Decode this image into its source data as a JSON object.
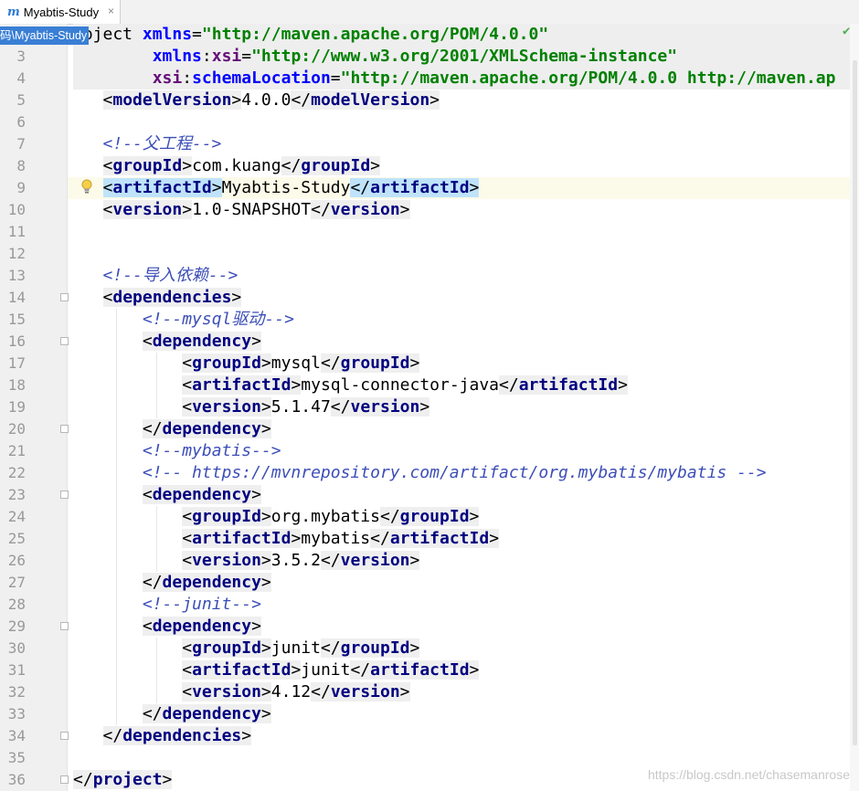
{
  "tab": {
    "title": "Myabtis-Study",
    "icon_letter": "m",
    "close": "×"
  },
  "breadcrumb": "码\\Myabtis-Study",
  "watermark": "https://blog.csdn.net/chasemanrose",
  "lines": [
    {
      "n": "",
      "top": true,
      "segs": [
        {
          "c": "pn",
          "t": "roject "
        },
        {
          "c": "an",
          "t": "xmlns"
        },
        {
          "c": "pn",
          "t": "="
        },
        {
          "c": "av",
          "t": "\"http://maven.apache.org/POM/4.0.0\""
        }
      ]
    },
    {
      "n": "3",
      "top": true,
      "segs": [
        {
          "c": "pn",
          "t": "        "
        },
        {
          "c": "an",
          "t": "xmlns"
        },
        {
          "c": "pn",
          "t": ":"
        },
        {
          "c": "ans",
          "t": "xsi"
        },
        {
          "c": "pn",
          "t": "="
        },
        {
          "c": "av",
          "t": "\"http://www.w3.org/2001/XMLSchema-instance\""
        }
      ]
    },
    {
      "n": "4",
      "top": true,
      "segs": [
        {
          "c": "pn",
          "t": "        "
        },
        {
          "c": "ans",
          "t": "xsi"
        },
        {
          "c": "pn",
          "t": ":"
        },
        {
          "c": "an",
          "t": "schemaLocation"
        },
        {
          "c": "pn",
          "t": "="
        },
        {
          "c": "av",
          "t": "\"http://maven.apache.org/POM/4.0.0 http://maven.ap"
        }
      ]
    },
    {
      "n": "5",
      "segs": [
        {
          "c": "pn",
          "t": "   "
        },
        {
          "c": "tagbg",
          "t": "<",
          "inner": [
            {
              "c": "t",
              "t": "modelVersion"
            }
          ],
          "close": ">"
        },
        {
          "c": "tx",
          "t": "4.0.0"
        },
        {
          "c": "tagbg",
          "t": "</",
          "inner": [
            {
              "c": "t",
              "t": "modelVersion"
            }
          ],
          "close": ">"
        }
      ]
    },
    {
      "n": "6",
      "segs": []
    },
    {
      "n": "7",
      "segs": [
        {
          "c": "pn",
          "t": "   "
        },
        {
          "c": "cm",
          "t": "<!--父工程-->"
        }
      ]
    },
    {
      "n": "8",
      "segs": [
        {
          "c": "pn",
          "t": "   "
        },
        {
          "c": "tagbg",
          "t": "<",
          "inner": [
            {
              "c": "t",
              "t": "groupId"
            }
          ],
          "close": ">"
        },
        {
          "c": "tx",
          "t": "com.kuang"
        },
        {
          "c": "tagbg",
          "t": "</",
          "inner": [
            {
              "c": "t",
              "t": "groupId"
            }
          ],
          "close": ">"
        }
      ]
    },
    {
      "n": "9",
      "cur": true,
      "segs": [
        {
          "c": "pn",
          "t": "   "
        },
        {
          "c": "tagsel",
          "t": "<",
          "inner": [
            {
              "c": "t",
              "t": "artifactId"
            }
          ],
          "close": ">"
        },
        {
          "c": "tx",
          "t": "Myabtis-Study"
        },
        {
          "c": "tagsel",
          "t": "</",
          "inner": [
            {
              "c": "t",
              "t": "artifactId"
            }
          ],
          "close": ">"
        }
      ]
    },
    {
      "n": "10",
      "segs": [
        {
          "c": "pn",
          "t": "   "
        },
        {
          "c": "tagbg",
          "t": "<",
          "inner": [
            {
              "c": "t",
              "t": "version"
            }
          ],
          "close": ">"
        },
        {
          "c": "tx",
          "t": "1.0-SNAPSHOT"
        },
        {
          "c": "tagbg",
          "t": "</",
          "inner": [
            {
              "c": "t",
              "t": "version"
            }
          ],
          "close": ">"
        }
      ]
    },
    {
      "n": "11",
      "segs": []
    },
    {
      "n": "12",
      "segs": []
    },
    {
      "n": "13",
      "segs": [
        {
          "c": "pn",
          "t": "   "
        },
        {
          "c": "cm",
          "t": "<!--导入依赖-->"
        }
      ]
    },
    {
      "n": "14",
      "fold": true,
      "segs": [
        {
          "c": "pn",
          "t": "   "
        },
        {
          "c": "tagbg",
          "t": "<",
          "inner": [
            {
              "c": "t",
              "t": "dependencies"
            }
          ],
          "close": ">"
        }
      ]
    },
    {
      "n": "15",
      "segs": [
        {
          "c": "pn",
          "t": "       "
        },
        {
          "c": "cm",
          "t": "<!--mysql驱动-->"
        }
      ]
    },
    {
      "n": "16",
      "fold": true,
      "segs": [
        {
          "c": "pn",
          "t": "       "
        },
        {
          "c": "tagbg",
          "t": "<",
          "inner": [
            {
              "c": "t",
              "t": "dependency"
            }
          ],
          "close": ">"
        }
      ]
    },
    {
      "n": "17",
      "segs": [
        {
          "c": "pn",
          "t": "           "
        },
        {
          "c": "tagbg",
          "t": "<",
          "inner": [
            {
              "c": "t",
              "t": "groupId"
            }
          ],
          "close": ">"
        },
        {
          "c": "tx",
          "t": "mysql"
        },
        {
          "c": "tagbg",
          "t": "</",
          "inner": [
            {
              "c": "t",
              "t": "groupId"
            }
          ],
          "close": ">"
        }
      ]
    },
    {
      "n": "18",
      "segs": [
        {
          "c": "pn",
          "t": "           "
        },
        {
          "c": "tagbg",
          "t": "<",
          "inner": [
            {
              "c": "t",
              "t": "artifactId"
            }
          ],
          "close": ">"
        },
        {
          "c": "tx",
          "t": "mysql-connector-java"
        },
        {
          "c": "tagbg",
          "t": "</",
          "inner": [
            {
              "c": "t",
              "t": "artifactId"
            }
          ],
          "close": ">"
        }
      ]
    },
    {
      "n": "19",
      "segs": [
        {
          "c": "pn",
          "t": "           "
        },
        {
          "c": "tagbg",
          "t": "<",
          "inner": [
            {
              "c": "t",
              "t": "version"
            }
          ],
          "close": ">"
        },
        {
          "c": "tx",
          "t": "5.1.47"
        },
        {
          "c": "tagbg",
          "t": "</",
          "inner": [
            {
              "c": "t",
              "t": "version"
            }
          ],
          "close": ">"
        }
      ]
    },
    {
      "n": "20",
      "fold": true,
      "segs": [
        {
          "c": "pn",
          "t": "       "
        },
        {
          "c": "tagbg",
          "t": "</",
          "inner": [
            {
              "c": "t",
              "t": "dependency"
            }
          ],
          "close": ">"
        }
      ]
    },
    {
      "n": "21",
      "segs": [
        {
          "c": "pn",
          "t": "       "
        },
        {
          "c": "cm",
          "t": "<!--mybatis-->"
        }
      ]
    },
    {
      "n": "22",
      "segs": [
        {
          "c": "pn",
          "t": "       "
        },
        {
          "c": "cm",
          "t": "<!-- https://mvnrepository.com/artifact/org.mybatis/mybatis -->"
        }
      ]
    },
    {
      "n": "23",
      "fold": true,
      "segs": [
        {
          "c": "pn",
          "t": "       "
        },
        {
          "c": "tagbg",
          "t": "<",
          "inner": [
            {
              "c": "t",
              "t": "dependency"
            }
          ],
          "close": ">"
        }
      ]
    },
    {
      "n": "24",
      "segs": [
        {
          "c": "pn",
          "t": "           "
        },
        {
          "c": "tagbg",
          "t": "<",
          "inner": [
            {
              "c": "t",
              "t": "groupId"
            }
          ],
          "close": ">"
        },
        {
          "c": "tx",
          "t": "org.mybatis"
        },
        {
          "c": "tagbg",
          "t": "</",
          "inner": [
            {
              "c": "t",
              "t": "groupId"
            }
          ],
          "close": ">"
        }
      ]
    },
    {
      "n": "25",
      "segs": [
        {
          "c": "pn",
          "t": "           "
        },
        {
          "c": "tagbg",
          "t": "<",
          "inner": [
            {
              "c": "t",
              "t": "artifactId"
            }
          ],
          "close": ">"
        },
        {
          "c": "tx",
          "t": "mybatis"
        },
        {
          "c": "tagbg",
          "t": "</",
          "inner": [
            {
              "c": "t",
              "t": "artifactId"
            }
          ],
          "close": ">"
        }
      ]
    },
    {
      "n": "26",
      "segs": [
        {
          "c": "pn",
          "t": "           "
        },
        {
          "c": "tagbg",
          "t": "<",
          "inner": [
            {
              "c": "t",
              "t": "version"
            }
          ],
          "close": ">"
        },
        {
          "c": "tx",
          "t": "3.5.2"
        },
        {
          "c": "tagbg",
          "t": "</",
          "inner": [
            {
              "c": "t",
              "t": "version"
            }
          ],
          "close": ">"
        }
      ]
    },
    {
      "n": "27",
      "segs": [
        {
          "c": "pn",
          "t": "       "
        },
        {
          "c": "tagbg",
          "t": "</",
          "inner": [
            {
              "c": "t",
              "t": "dependency"
            }
          ],
          "close": ">"
        }
      ]
    },
    {
      "n": "28",
      "segs": [
        {
          "c": "pn",
          "t": "       "
        },
        {
          "c": "cm",
          "t": "<!--junit-->"
        }
      ]
    },
    {
      "n": "29",
      "fold": true,
      "segs": [
        {
          "c": "pn",
          "t": "       "
        },
        {
          "c": "tagbg",
          "t": "<",
          "inner": [
            {
              "c": "t",
              "t": "dependency"
            }
          ],
          "close": ">"
        }
      ]
    },
    {
      "n": "30",
      "segs": [
        {
          "c": "pn",
          "t": "           "
        },
        {
          "c": "tagbg",
          "t": "<",
          "inner": [
            {
              "c": "t",
              "t": "groupId"
            }
          ],
          "close": ">"
        },
        {
          "c": "tx",
          "t": "junit"
        },
        {
          "c": "tagbg",
          "t": "</",
          "inner": [
            {
              "c": "t",
              "t": "groupId"
            }
          ],
          "close": ">"
        }
      ]
    },
    {
      "n": "31",
      "segs": [
        {
          "c": "pn",
          "t": "           "
        },
        {
          "c": "tagbg",
          "t": "<",
          "inner": [
            {
              "c": "t",
              "t": "artifactId"
            }
          ],
          "close": ">"
        },
        {
          "c": "tx",
          "t": "junit"
        },
        {
          "c": "tagbg",
          "t": "</",
          "inner": [
            {
              "c": "t",
              "t": "artifactId"
            }
          ],
          "close": ">"
        }
      ]
    },
    {
      "n": "32",
      "segs": [
        {
          "c": "pn",
          "t": "           "
        },
        {
          "c": "tagbg",
          "t": "<",
          "inner": [
            {
              "c": "t",
              "t": "version"
            }
          ],
          "close": ">"
        },
        {
          "c": "tx",
          "t": "4.12"
        },
        {
          "c": "tagbg",
          "t": "</",
          "inner": [
            {
              "c": "t",
              "t": "version"
            }
          ],
          "close": ">"
        }
      ]
    },
    {
      "n": "33",
      "segs": [
        {
          "c": "pn",
          "t": "       "
        },
        {
          "c": "tagbg",
          "t": "</",
          "inner": [
            {
              "c": "t",
              "t": "dependency"
            }
          ],
          "close": ">"
        }
      ]
    },
    {
      "n": "34",
      "fold": true,
      "segs": [
        {
          "c": "pn",
          "t": "   "
        },
        {
          "c": "tagbg",
          "t": "</",
          "inner": [
            {
              "c": "t",
              "t": "dependencies"
            }
          ],
          "close": ">"
        }
      ]
    },
    {
      "n": "35",
      "segs": []
    },
    {
      "n": "36",
      "fold": true,
      "segs": [
        {
          "c": "tagbg",
          "t": "</",
          "inner": [
            {
              "c": "t",
              "t": "project"
            }
          ],
          "close": ">"
        }
      ]
    }
  ]
}
